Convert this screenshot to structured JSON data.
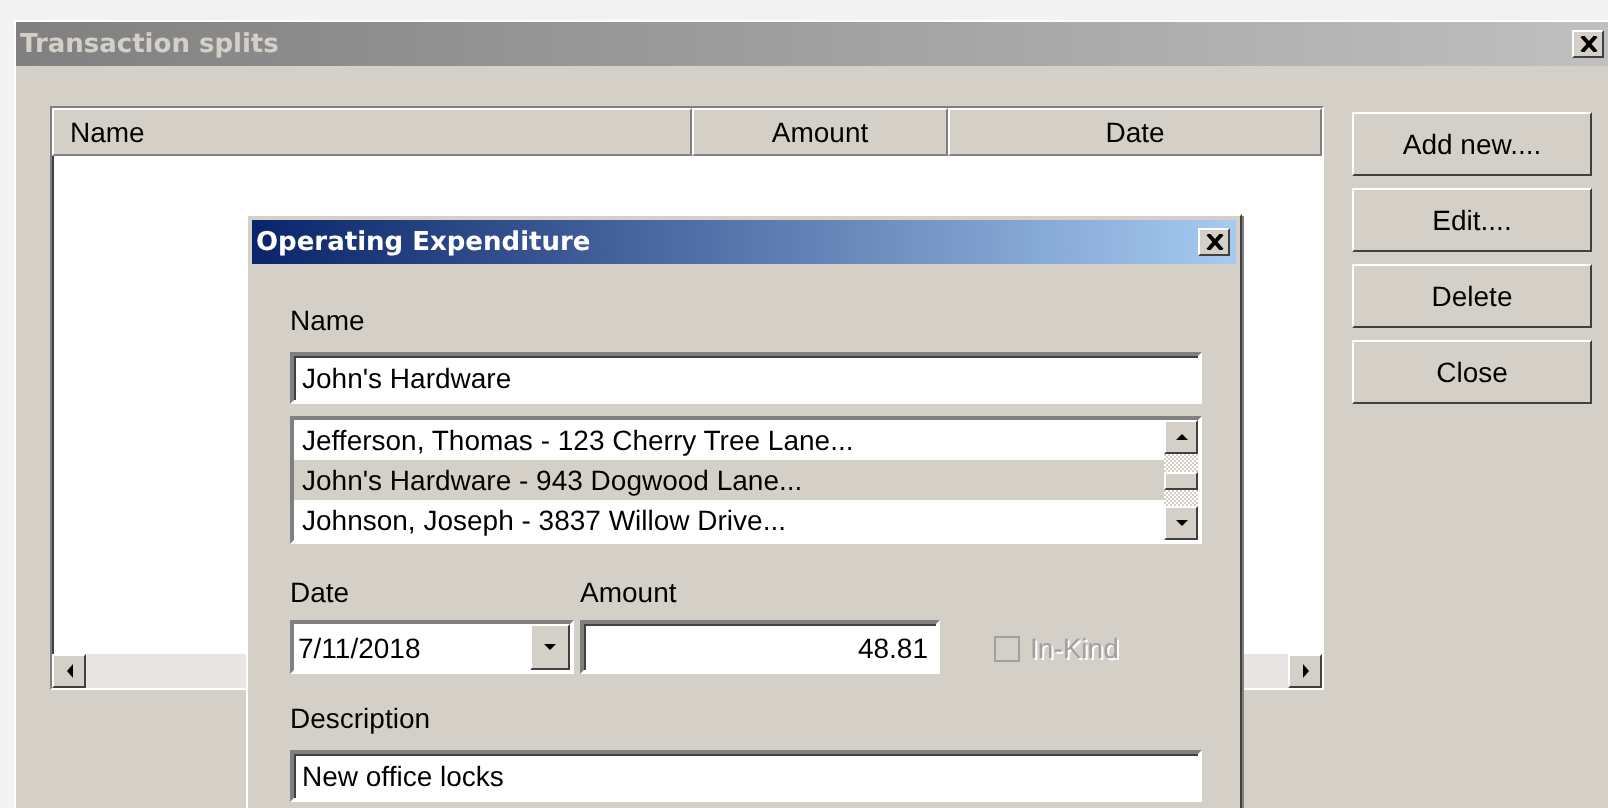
{
  "window": {
    "title": "Transaction splits"
  },
  "table": {
    "columns": [
      "Name",
      "Amount",
      "Date"
    ]
  },
  "buttons": [
    "Add new....",
    "Edit....",
    "Delete",
    "Close"
  ],
  "dialog": {
    "title": "Operating Expenditure",
    "name_label": "Name",
    "name_value": "John's Hardware",
    "suggestions": [
      {
        "text": "Jefferson, Thomas - 123 Cherry Tree Lane...",
        "selected": false
      },
      {
        "text": "John's Hardware - 943 Dogwood Lane...",
        "selected": true
      },
      {
        "text": "Johnson, Joseph - 3837 Willow Drive...",
        "selected": false
      }
    ],
    "date_label": "Date",
    "date_value": "7/11/2018",
    "amount_label": "Amount",
    "amount_value": "48.81",
    "in_kind": {
      "label": "In-Kind",
      "checked": false,
      "disabled": true
    },
    "description_label": "Description",
    "description_value": "New office locks"
  }
}
